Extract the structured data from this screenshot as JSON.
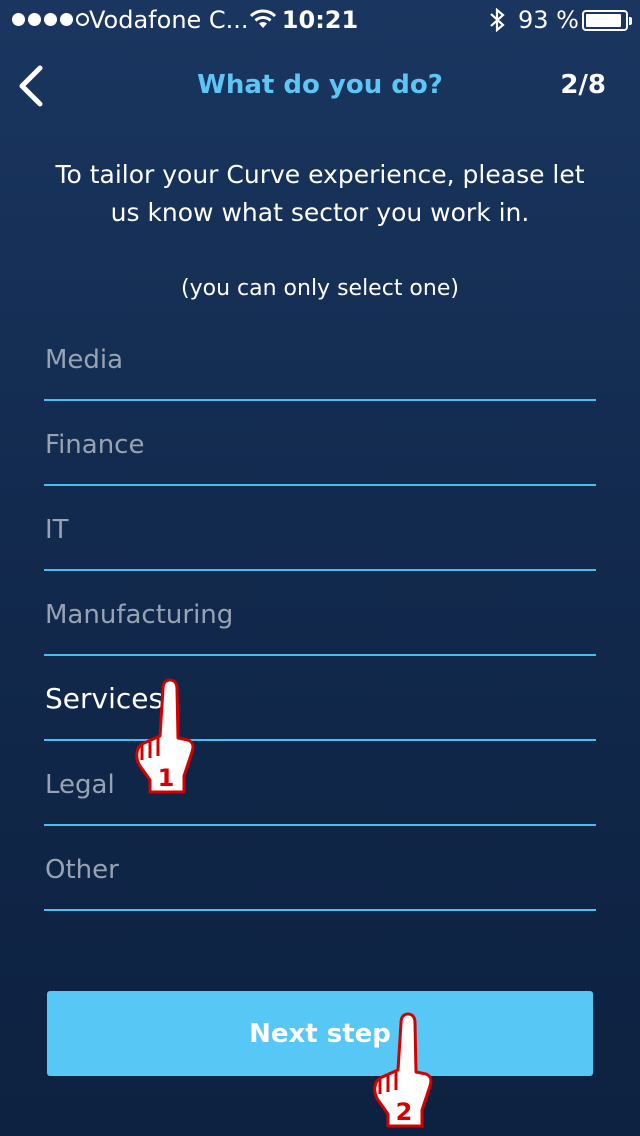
{
  "status_bar": {
    "carrier": "Vodafone C...",
    "time": "10:21",
    "battery": "93 %",
    "battery_level": 0.93
  },
  "nav": {
    "back_icon": "chevron-left-icon",
    "title": "What do you do?",
    "progress": "2/8"
  },
  "intro": {
    "text": "To tailor your Curve experience, please let us know what sector you work in.",
    "hint": "(you can only select one)"
  },
  "options": [
    {
      "label": "Media",
      "selected": false
    },
    {
      "label": "Finance",
      "selected": false
    },
    {
      "label": "IT",
      "selected": false
    },
    {
      "label": "Manufacturing",
      "selected": false
    },
    {
      "label": "Services",
      "selected": true
    },
    {
      "label": "Legal",
      "selected": false
    },
    {
      "label": "Other",
      "selected": false
    }
  ],
  "next_button": {
    "label": "Next step"
  },
  "annotations": [
    {
      "icon": "pointing-hand-icon",
      "step": "1"
    },
    {
      "icon": "pointing-hand-icon",
      "step": "2"
    }
  ],
  "colors": {
    "accent": "#57c8f5",
    "title": "#5ec6f5",
    "divider": "#4cbdf0",
    "annotation": "#d40000"
  }
}
